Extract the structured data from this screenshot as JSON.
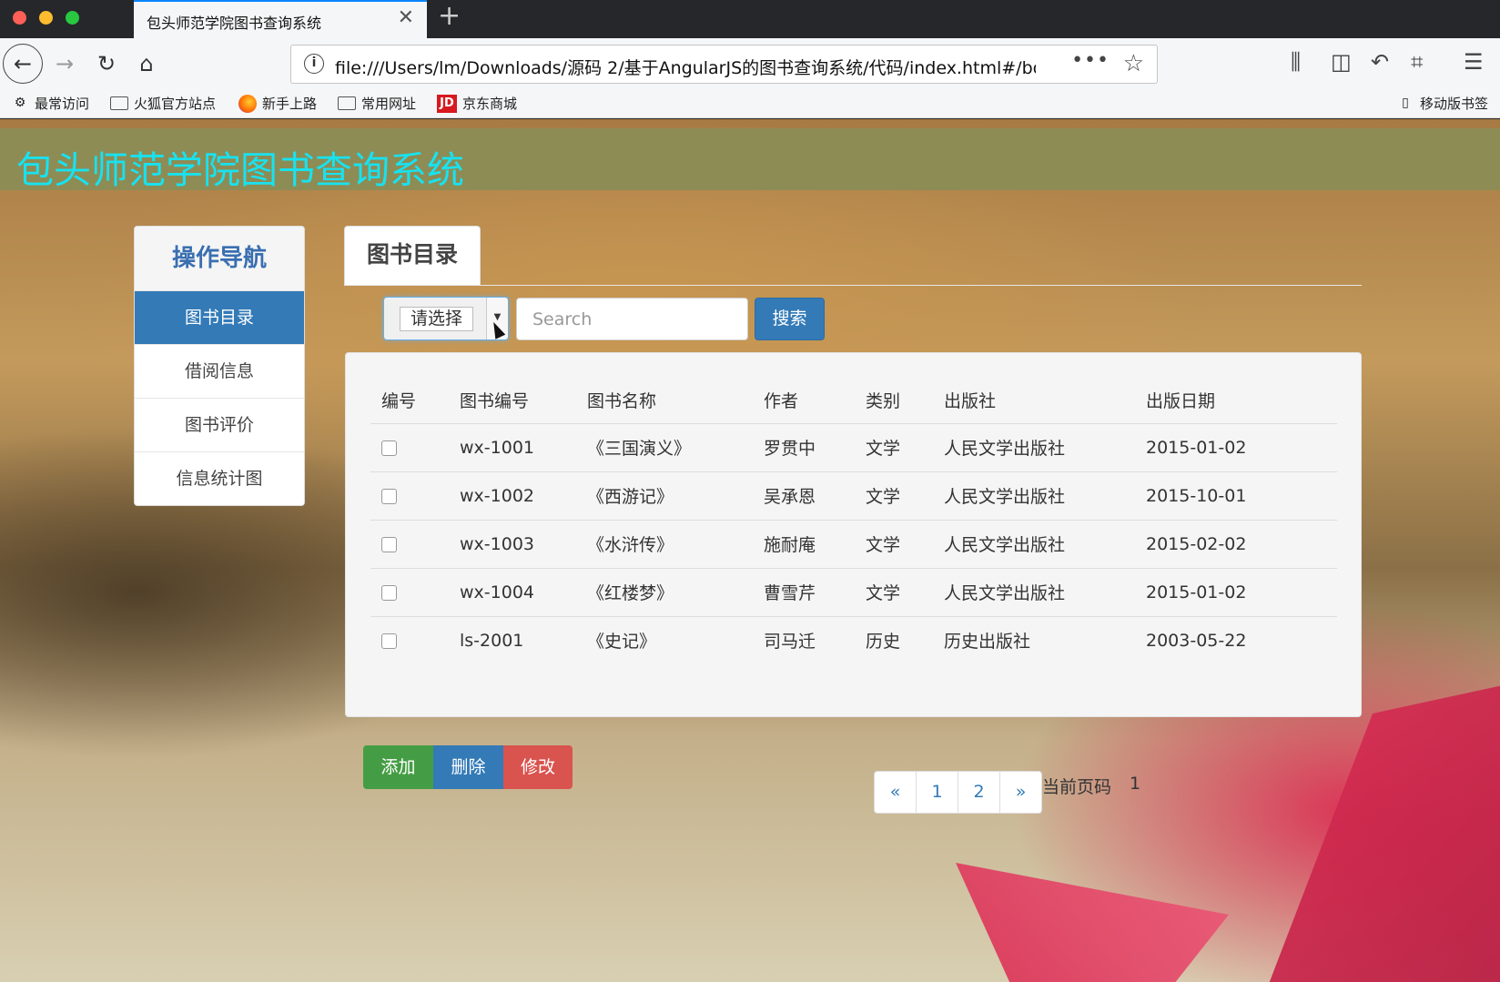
{
  "browser": {
    "tab_title": "包头师范学院图书查询系统",
    "tab_close": "✕",
    "new_tab": "+",
    "url": "file:///Users/lm/Downloads/源码 2/基于AngularJS的图书查询系统/代码/index.html#/boo",
    "url_more": "•••",
    "bookmarks": [
      {
        "label": "最常访问",
        "icon": "gear-icon"
      },
      {
        "label": "火狐官方站点",
        "icon": "folder-icon"
      },
      {
        "label": "新手上路",
        "icon": "firefox-icon"
      },
      {
        "label": "常用网址",
        "icon": "folder-icon"
      },
      {
        "label": "京东商城",
        "icon": "jd-icon"
      }
    ],
    "mobile_bookmarks": "移动版书签",
    "jd_glyph": "JD"
  },
  "site": {
    "title": "包头师范学院图书查询系统"
  },
  "sidenav": {
    "title": "操作导航",
    "items": [
      {
        "label": "图书目录",
        "active": true
      },
      {
        "label": "借阅信息",
        "active": false
      },
      {
        "label": "图书评价",
        "active": false
      },
      {
        "label": "信息统计图",
        "active": false
      }
    ]
  },
  "main": {
    "tab_label": "图书目录",
    "select_value": "请选择",
    "search_placeholder": "Search",
    "search_button": "搜索",
    "table": {
      "headers": [
        "编号",
        "图书编号",
        "图书名称",
        "作者",
        "类别",
        "出版社",
        "出版日期"
      ],
      "rows": [
        {
          "book_id": "wx-1001",
          "name": "《三国演义》",
          "author": "罗贯中",
          "category": "文学",
          "publisher": "人民文学出版社",
          "date": "2015-01-02"
        },
        {
          "book_id": "wx-1002",
          "name": "《西游记》",
          "author": "吴承恩",
          "category": "文学",
          "publisher": "人民文学出版社",
          "date": "2015-10-01"
        },
        {
          "book_id": "wx-1003",
          "name": "《水浒传》",
          "author": "施耐庵",
          "category": "文学",
          "publisher": "人民文学出版社",
          "date": "2015-02-02"
        },
        {
          "book_id": "wx-1004",
          "name": "《红楼梦》",
          "author": "曹雪芹",
          "category": "文学",
          "publisher": "人民文学出版社",
          "date": "2015-01-02"
        },
        {
          "book_id": "ls-2001",
          "name": "《史记》",
          "author": "司马迁",
          "category": "历史",
          "publisher": "历史出版社",
          "date": "2003-05-22"
        }
      ]
    },
    "actions": {
      "add": "添加",
      "delete": "删除",
      "edit": "修改"
    },
    "pagination": {
      "prev": "«",
      "pages": [
        "1",
        "2"
      ],
      "next": "»",
      "current_label": "当前页码",
      "current": "1"
    }
  },
  "colors": {
    "header_bg": "#8d8c55",
    "title_color": "#18e2f0",
    "primary": "#337ab7",
    "success": "#449d44",
    "danger": "#d9534f"
  }
}
